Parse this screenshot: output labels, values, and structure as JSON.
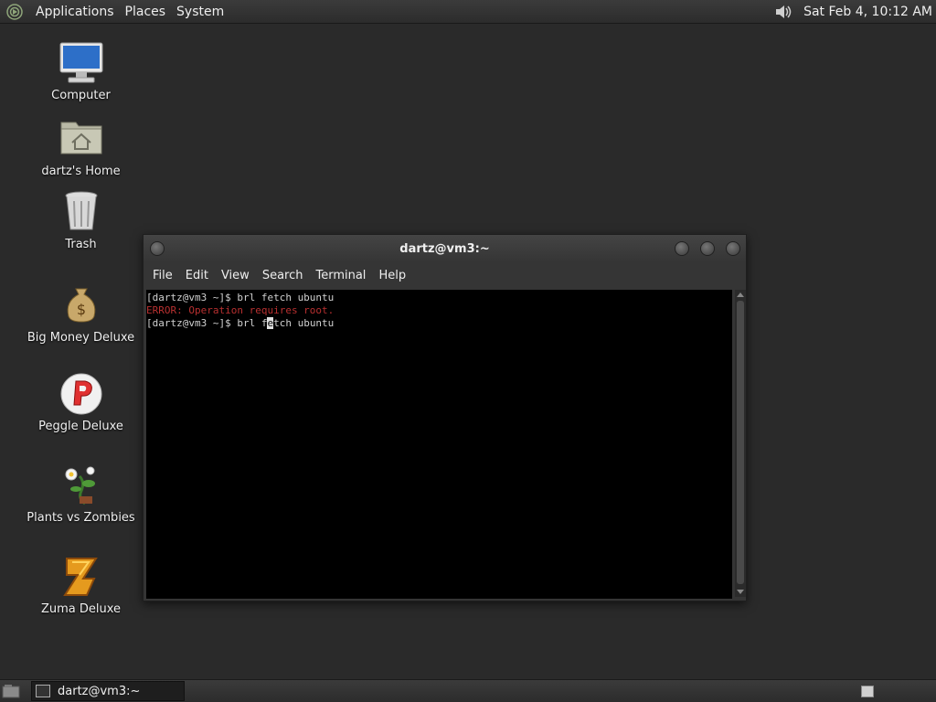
{
  "top_panel": {
    "menus": [
      "Applications",
      "Places",
      "System"
    ],
    "clock": "Sat Feb  4, 10:12 AM",
    "volume_icon": "speaker-icon"
  },
  "desktop": {
    "icons": [
      {
        "label": "Computer",
        "icon": "computer-icon"
      },
      {
        "label": "dartz's Home",
        "icon": "home-folder-icon"
      },
      {
        "label": "Trash",
        "icon": "trash-icon"
      },
      {
        "label": "Big Money Deluxe",
        "icon": "money-bag-icon"
      },
      {
        "label": "Peggle Deluxe",
        "icon": "peggle-icon"
      },
      {
        "label": "Plants vs Zombies",
        "icon": "plants-vs-zombies-icon"
      },
      {
        "label": "Zuma Deluxe",
        "icon": "zuma-icon"
      }
    ]
  },
  "terminal": {
    "title": "dartz@vm3:~",
    "menu": [
      "File",
      "Edit",
      "View",
      "Search",
      "Terminal",
      "Help"
    ],
    "lines": [
      {
        "text": "[dartz@vm3 ~]$ brl fetch ubuntu",
        "type": "normal"
      },
      {
        "text": "ERROR: Operation requires root.",
        "type": "error"
      },
      {
        "prefix": "[dartz@vm3 ~]$ brl f",
        "cursor": "e",
        "suffix": "tch ubuntu",
        "type": "prompt"
      }
    ],
    "colors": {
      "error": "#b83030",
      "text": "#d0d0d0",
      "background": "#000000"
    }
  },
  "bottom_panel": {
    "task_label": "dartz@vm3:~"
  }
}
